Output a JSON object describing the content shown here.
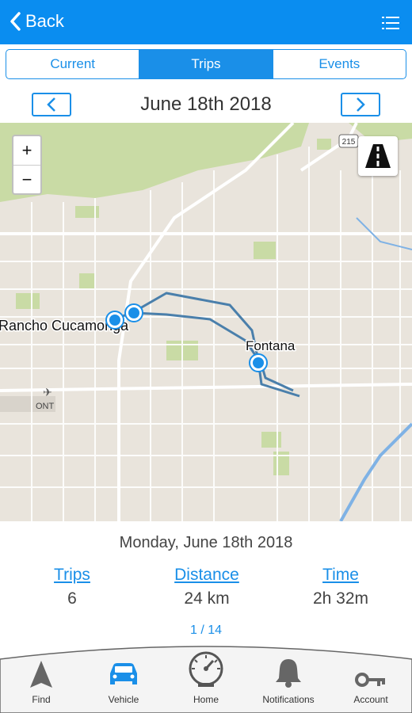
{
  "header": {
    "back_label": "Back"
  },
  "segments": [
    {
      "label": "Current",
      "active": false
    },
    {
      "label": "Trips",
      "active": true
    },
    {
      "label": "Events",
      "active": false
    }
  ],
  "date_nav": {
    "title": "June 18th 2018"
  },
  "map": {
    "places": {
      "rancho": "Rancho Cucamonga",
      "fontana": "Fontana",
      "ont": "ONT",
      "highway": "215"
    },
    "zoom_in": "+",
    "zoom_out": "−"
  },
  "summary": {
    "title": "Monday, June 18th 2018",
    "trips_label": "Trips",
    "trips_value": "6",
    "distance_label": "Distance",
    "distance_value": "24 km",
    "time_label": "Time",
    "time_value": "2h 32m",
    "pager": "1 / 14"
  },
  "tabs": [
    {
      "label": "Find",
      "icon": "navigation-arrow-icon"
    },
    {
      "label": "Vehicle",
      "icon": "car-icon",
      "active": true
    },
    {
      "label": "Home",
      "icon": "speedometer-icon"
    },
    {
      "label": "Notifications",
      "icon": "bell-icon"
    },
    {
      "label": "Account",
      "icon": "key-icon"
    }
  ],
  "colors": {
    "accent": "#0a8df0",
    "route": "#4a7fab",
    "park": "#c9dba5"
  }
}
